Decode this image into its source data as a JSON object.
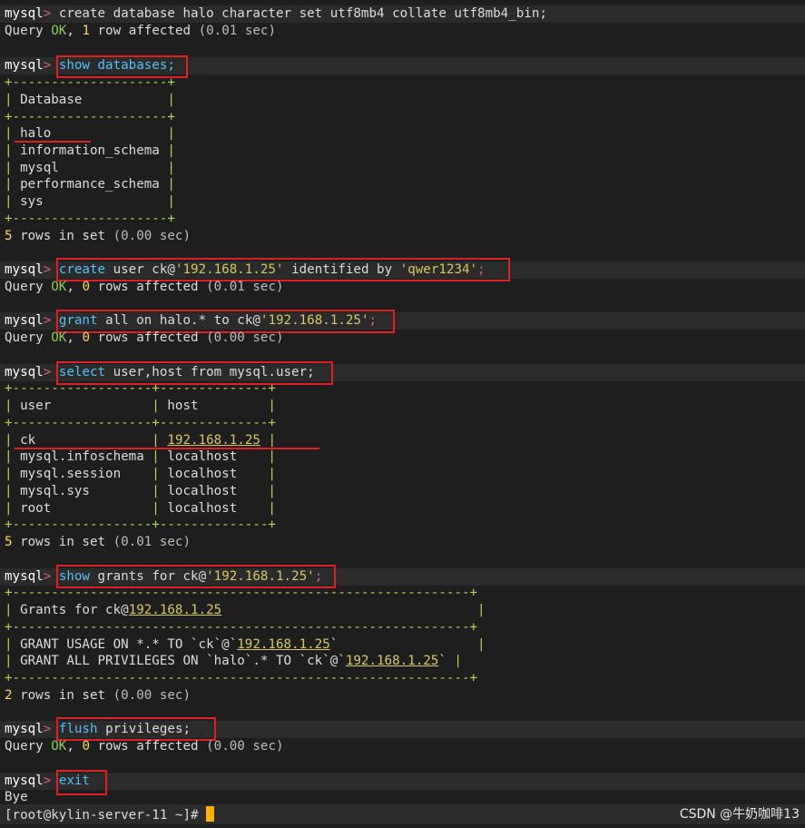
{
  "terminal": {
    "prompt": "mysql",
    "prompt_sep": ">",
    "lines": {
      "l1": "create database halo character set utf8mb4 collate utf8mb4_bin;",
      "l2a": "Query ",
      "l2ok": "OK",
      "l2b": ", ",
      "l2n": "1",
      "l2c": " row affected ",
      "l2t": "(0.01 sec)",
      "l3": "show databases;",
      "db_header": "Database",
      "db_rows": [
        "halo",
        "information_schema",
        "mysql",
        "performance_schema",
        "sys"
      ],
      "db_border": "+--------------------+",
      "db_count": "5",
      "db_count_rest": " rows in set ",
      "db_time": "(0.00 sec)",
      "cu_cmd": "create",
      "cu_rest": " user ck@",
      "cu_host": "'192.168.1.25'",
      "cu_mid": " identified by ",
      "cu_pwd": "'qwer1234'",
      "cu_end": ";",
      "cu_res_a": "Query ",
      "cu_res_ok": "OK",
      "cu_res_b": ", ",
      "cu_res_n": "0",
      "cu_res_c": " rows affected ",
      "cu_res_t": "(0.01 sec)",
      "gr_cmd": "grant",
      "gr_rest": " all on halo.* to ck@",
      "gr_host": "'192.168.1.25'",
      "gr_end": ";",
      "gr_res_t": "(0.00 sec)",
      "sel_cmd": "select",
      "sel_rest": " user,host from mysql.user;",
      "ut_border": "+------------------+--------------+",
      "ut_h_user": "user",
      "ut_h_host": "host",
      "ut_rows": [
        {
          "user": "ck",
          "host": "192.168.1.25"
        },
        {
          "user": "mysql.infoschema",
          "host": "localhost"
        },
        {
          "user": "mysql.session",
          "host": "localhost"
        },
        {
          "user": "mysql.sys",
          "host": "localhost"
        },
        {
          "user": "root",
          "host": "localhost"
        }
      ],
      "ut_time": "(0.01 sec)",
      "sg_cmd": "show",
      "sg_rest": " grants for ck@",
      "sg_host": "'192.168.1.25'",
      "sg_end": ";",
      "g_border": "+-----------------------------------------------------------+",
      "g_header_a": "Grants for ck@",
      "g_header_ip": "192.168.1.25",
      "g1_a": "GRANT USAGE ON *.* TO `ck`@`",
      "g1_ip": "192.168.1.25",
      "g1_b": "`",
      "g2_a": "GRANT ALL PRIVILEGES ON `halo`.* TO `ck`@`",
      "g2_ip": "192.168.1.25",
      "g2_b": "`",
      "g_count": "2",
      "g_time": "(0.00 sec)",
      "fl_cmd": "flush",
      "fl_rest": " privileges;",
      "fl_time": "(0.00 sec)",
      "exit_cmd": "exit",
      "bye": "Bye",
      "shell_prompt": "[root@kylin-server-11 ~]#"
    }
  },
  "watermark": "CSDN @牛奶咖啡13",
  "colors": {
    "accent_red": "#e02020",
    "keyword": "#4fc3f7",
    "string": "#d7c95a",
    "ok": "#8bd14a",
    "cursor": "#ffb000"
  }
}
